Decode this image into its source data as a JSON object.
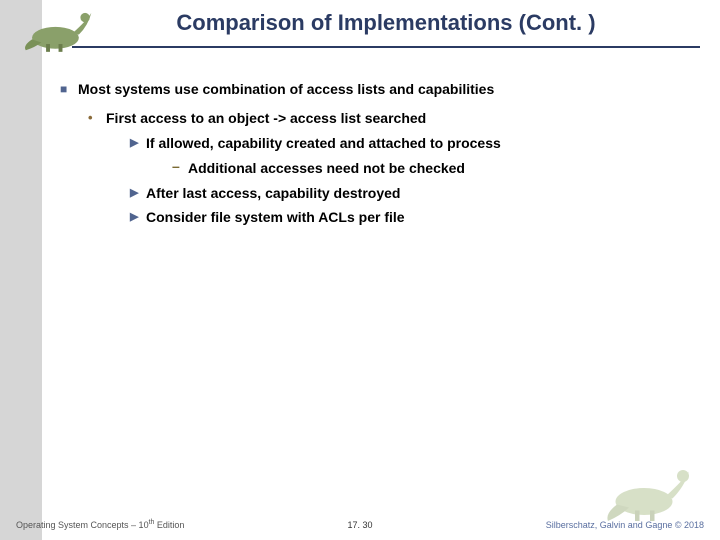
{
  "title": "Comparison of Implementations (Cont. )",
  "bullets": {
    "l1": "Most systems use combination of access lists and capabilities",
    "l2": "First access to an object -> access list searched",
    "l3a": "If allowed, capability created and attached to process",
    "l4": "Additional accesses need not be checked",
    "l3b": "After last access, capability destroyed",
    "l3c": "Consider file system with ACLs per file"
  },
  "footer": {
    "left_prefix": "Operating System Concepts – 10",
    "left_suffix": " Edition",
    "left_sup": "th",
    "center": "17. 30",
    "right": "Silberschatz, Galvin and Gagne © 2018"
  },
  "icons": {
    "dino_small": "dinosaur-small-icon",
    "dino_big": "dinosaur-large-icon"
  },
  "colors": {
    "heading": "#2b3b63",
    "sidebar": "#d6d6d6",
    "footer_right": "#5a6fa0"
  }
}
